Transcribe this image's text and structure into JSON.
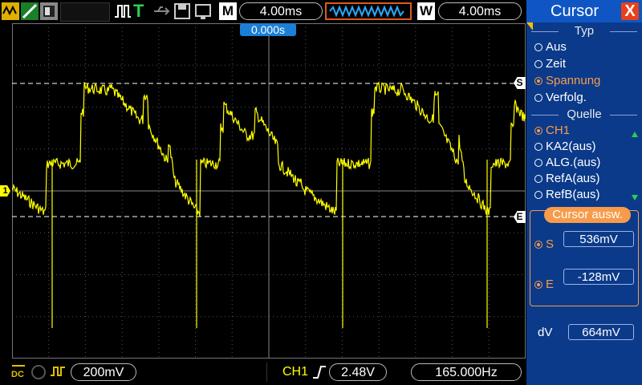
{
  "top": {
    "menu_key": "M",
    "timebase": "4.00ms",
    "window_key": "W",
    "window_timebase": "4.00ms",
    "trigger_pos": "0.000s",
    "trigger_mode_icon": "T"
  },
  "bottom": {
    "ch1_coupling": "DC",
    "ch1_scale": "200mV",
    "trig_source": "CH1",
    "trig_level": "2.48V",
    "frequency": "165.000Hz"
  },
  "markers": {
    "cursor_s": "S",
    "cursor_e": "E",
    "ch1_marker": "1"
  },
  "panel": {
    "title": "Cursor",
    "close": "X",
    "type_header": "Typ",
    "types": [
      "Aus",
      "Zeit",
      "Spannung",
      "Verfolg."
    ],
    "type_selected": 2,
    "source_header": "Quelle",
    "sources": [
      "CH1",
      "KA2(aus)",
      "ALG.(aus)",
      "RefA(aus)",
      "RefB(aus)"
    ],
    "source_selected": 0,
    "cursor_select": "Cursor  ausw.",
    "s_label": "S",
    "s_value": "536mV",
    "e_label": "E",
    "e_value": "-128mV",
    "dv_label": "dV",
    "dv_value": "664mV"
  },
  "colors": {
    "trace": "#ffff00",
    "accent": "#f79b4a",
    "panel": "#0b3a8a",
    "close": "#e8401a"
  }
}
